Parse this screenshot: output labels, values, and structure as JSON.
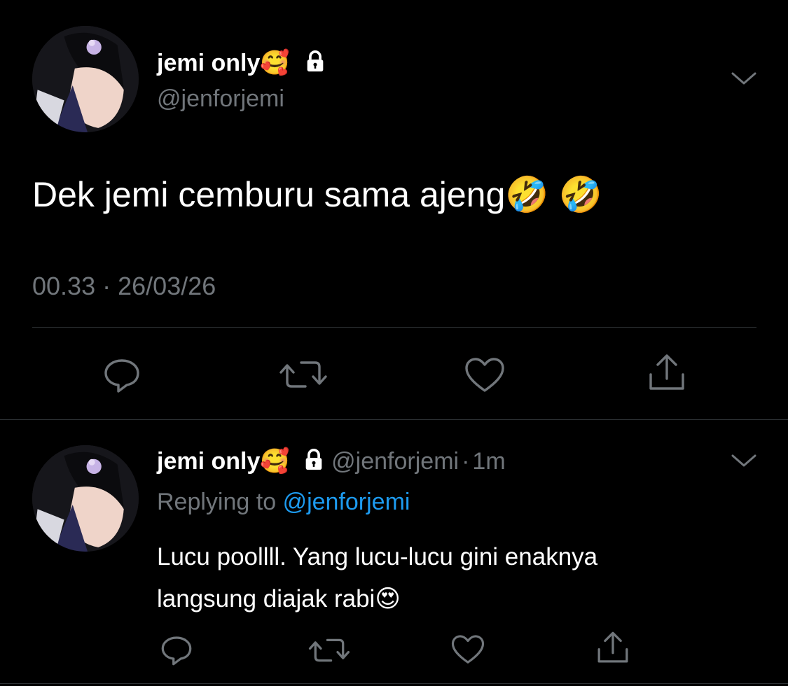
{
  "main_tweet": {
    "display_name": "jemi only",
    "name_emoji": "🥰",
    "handle": "@jenforjemi",
    "text": "Dek jemi cemburu sama ajeng",
    "text_emojis": "🤣 🤣",
    "time": "00.33",
    "separator": "·",
    "date": "26/03/26",
    "icons": [
      "reply-icon",
      "retweet-icon",
      "like-icon",
      "share-icon"
    ]
  },
  "reply_tweet": {
    "display_name": "jemi only",
    "name_emoji": "🥰",
    "handle": "@jenforjemi",
    "separator": "·",
    "age": "1m",
    "replying_to_label": "Replying to",
    "replying_to_handle": "@jenforjemi",
    "text_line1": "Lucu poollll. Yang lucu-lucu gini enaknya",
    "text_line2": "langsung diajak rabi",
    "text_emoji": "😍",
    "icons": [
      "reply-icon",
      "retweet-icon",
      "like-icon",
      "share-icon"
    ]
  },
  "colors": {
    "background": "#000000",
    "text": "#ffffff",
    "muted": "#71767b",
    "link": "#1d9bf0",
    "divider": "#2f3336"
  }
}
